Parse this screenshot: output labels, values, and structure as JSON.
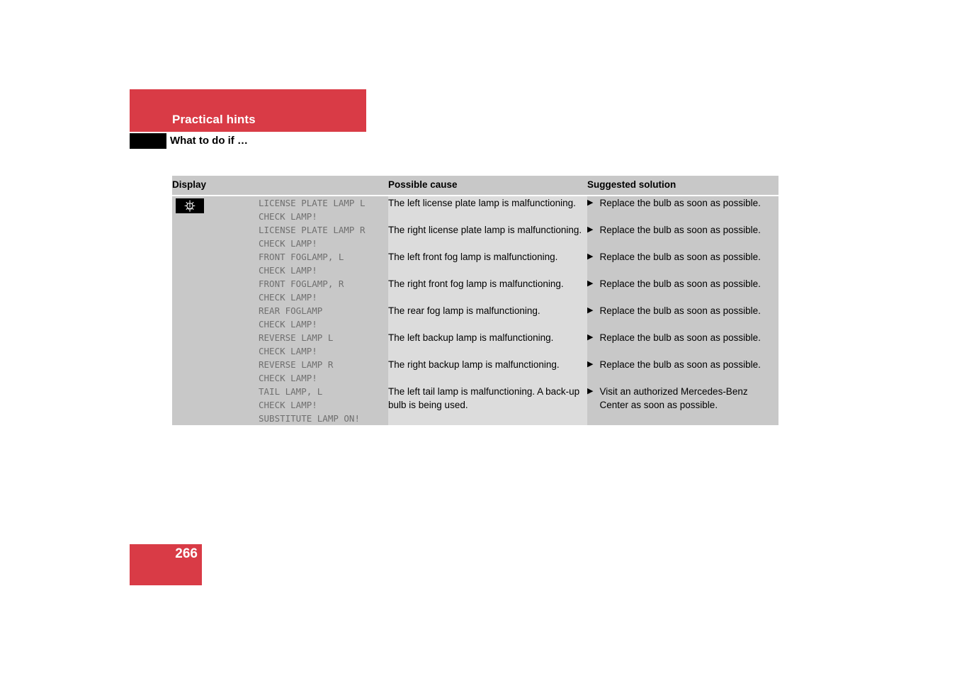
{
  "header": {
    "chapter": "Practical hints",
    "section": "What to do if …",
    "chapter_bg": "#d93b46",
    "marker_bg": "#000000"
  },
  "table": {
    "columns": {
      "display": "Display",
      "cause": "Possible cause",
      "solution": "Suggested solution"
    },
    "icon": {
      "name": "lamp-warning-icon",
      "background": "#000000",
      "foreground": "#ffffff"
    },
    "rows": [
      {
        "display": "LICENSE PLATE LAMP L\nCHECK LAMP!",
        "cause": "The left license plate lamp is malfunctioning.",
        "bullet": "▶",
        "solution": "Replace the bulb as soon as possible."
      },
      {
        "display": "LICENSE PLATE LAMP R\nCHECK LAMP!",
        "cause": "The right license plate lamp is malfunctioning.",
        "bullet": "▶",
        "solution": "Replace the bulb as soon as possible."
      },
      {
        "display": "FRONT FOGLAMP, L\nCHECK LAMP!",
        "cause": "The left front fog lamp is malfunctioning.",
        "bullet": "▶",
        "solution": "Replace the bulb as soon as possible."
      },
      {
        "display": "FRONT FOGLAMP, R\nCHECK LAMP!",
        "cause": "The right front fog lamp is malfunctioning.",
        "bullet": "▶",
        "solution": "Replace the bulb as soon as possible."
      },
      {
        "display": "REAR FOGLAMP\nCHECK LAMP!",
        "cause": "The rear fog lamp is malfunctioning.",
        "bullet": "▶",
        "solution": "Replace the bulb as soon as possible."
      },
      {
        "display": "REVERSE LAMP L\nCHECK LAMP!",
        "cause": "The left backup lamp is malfunctioning.",
        "bullet": "▶",
        "solution": "Replace the bulb as soon as possible."
      },
      {
        "display": "REVERSE LAMP R\nCHECK LAMP!",
        "cause": "The right backup lamp is malfunctioning.",
        "bullet": "▶",
        "solution": "Replace the bulb as soon as possible."
      },
      {
        "display": "TAIL LAMP, L\nCHECK LAMP!\nSUBSTITUTE LAMP ON!",
        "cause": "The left tail lamp is malfunctioning. A back-up bulb is being used.",
        "bullet": "▶",
        "solution": "Visit an authorized Mercedes-Benz Center as soon as possible."
      }
    ]
  },
  "footer": {
    "page_number": "266",
    "page_bg": "#d93b46"
  }
}
